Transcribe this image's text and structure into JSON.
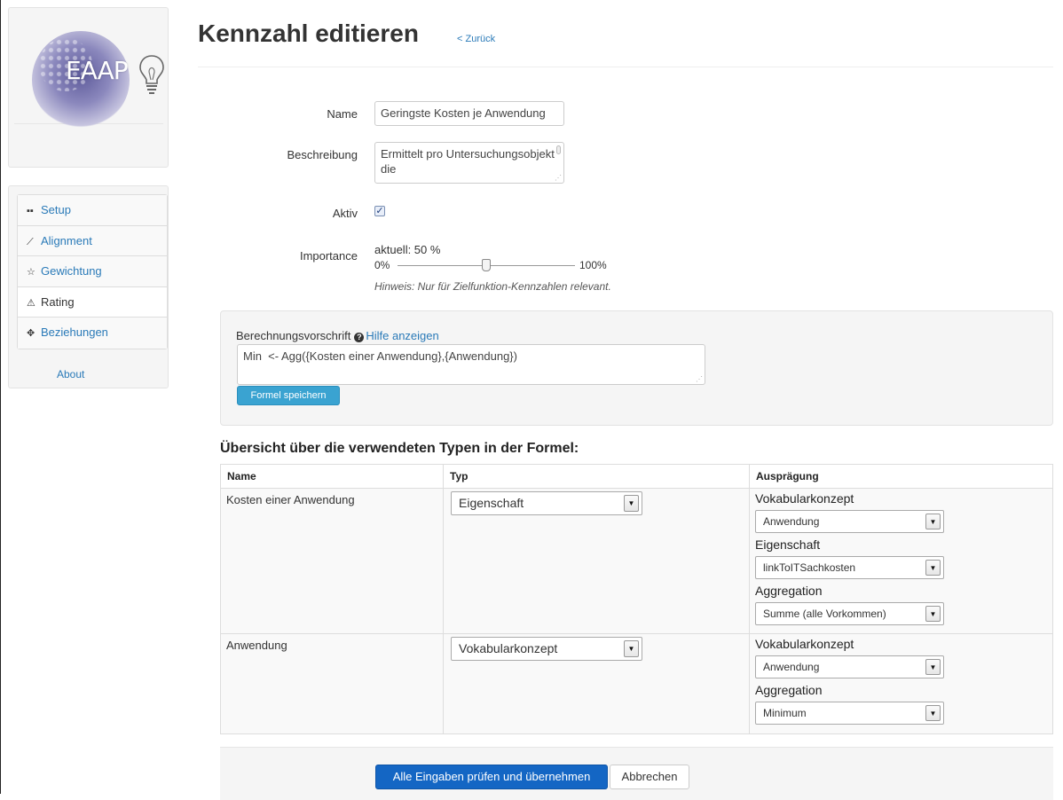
{
  "logo": {
    "text": "EAAP"
  },
  "sidebar": {
    "items": [
      {
        "label": "Setup",
        "icon": "grid-icon",
        "glyph": "▪▪"
      },
      {
        "label": "Alignment",
        "icon": "wand-icon",
        "glyph": "⟋"
      },
      {
        "label": "Gewichtung",
        "icon": "star-icon",
        "glyph": "☆"
      },
      {
        "label": "Rating",
        "icon": "warning-icon",
        "glyph": "⚠"
      },
      {
        "label": "Beziehungen",
        "icon": "move-icon",
        "glyph": "✥"
      }
    ],
    "active": "Rating",
    "about": "About"
  },
  "header": {
    "title": "Kennzahl editieren",
    "back": "< Zurück"
  },
  "form": {
    "name_label": "Name",
    "name_value": "Geringste Kosten je Anwendung",
    "desc_label": "Beschreibung",
    "desc_value": "Ermittelt pro Untersuchungsobjekt die",
    "active_label": "Aktiv",
    "active_checked": true,
    "importance_label": "Importance",
    "importance_current": "aktuell: 50 %",
    "importance_value": 50,
    "slider_min": "0%",
    "slider_max": "100%",
    "hint": "Hinweis: Nur für Zielfunktion-Kennzahlen relevant."
  },
  "formula": {
    "label": "Berechnungsvorschrift",
    "help_link": "Hilfe anzeigen",
    "value": "Min  <- Agg({Kosten einer Anwendung},{Anwendung})",
    "save_button": "Formel speichern"
  },
  "types": {
    "heading": "Übersicht über die verwendeten Typen in der Formel:",
    "columns": [
      "Name",
      "Typ",
      "Ausprägung"
    ],
    "rows": [
      {
        "name": "Kosten einer Anwendung",
        "typ": "Eigenschaft",
        "fields": [
          {
            "label": "Vokabularkonzept",
            "value": "Anwendung"
          },
          {
            "label": "Eigenschaft",
            "value": "linkToITSachkosten"
          },
          {
            "label": "Aggregation",
            "value": "Summe (alle Vorkommen)"
          }
        ]
      },
      {
        "name": "Anwendung",
        "typ": "Vokabularkonzept",
        "fields": [
          {
            "label": "Vokabularkonzept",
            "value": "Anwendung"
          },
          {
            "label": "Aggregation",
            "value": "Minimum"
          }
        ]
      }
    ]
  },
  "footer": {
    "submit": "Alle Eingaben prüfen und übernehmen",
    "cancel": "Abbrechen"
  },
  "colors": {
    "link": "#2a7ab8",
    "primary": "#1466c4",
    "info": "#3aa3d1"
  }
}
